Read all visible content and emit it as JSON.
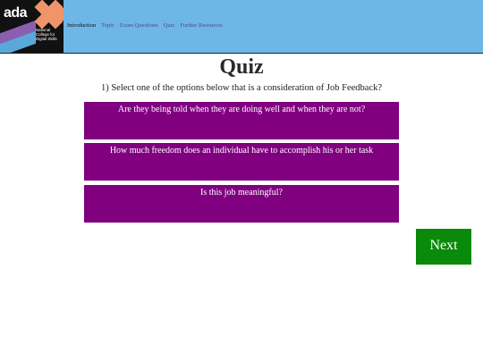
{
  "logo": {
    "wordmark": "ada",
    "college_text": "National College for Digital Skills"
  },
  "nav": {
    "items": [
      {
        "label": "Introduction",
        "active": true
      },
      {
        "label": "Topic",
        "active": false
      },
      {
        "label": "Exam Questions",
        "active": false
      },
      {
        "label": "Quiz",
        "active": false
      },
      {
        "label": "Further Resources",
        "active": false
      }
    ]
  },
  "quiz": {
    "title": "Quiz",
    "question": "1) Select one of the options below that is a consideration of Job Feedback?",
    "options": [
      {
        "label": "Are they being told when they are doing well and when they are not?"
      },
      {
        "label": "How much freedom does an individual have to accomplish his or her task"
      },
      {
        "label": "Is this job meaningful?"
      }
    ],
    "next_label": "Next"
  },
  "colors": {
    "header_bg": "#6db6e6",
    "option_bg": "#800080",
    "next_bg": "#0a8a0a"
  }
}
